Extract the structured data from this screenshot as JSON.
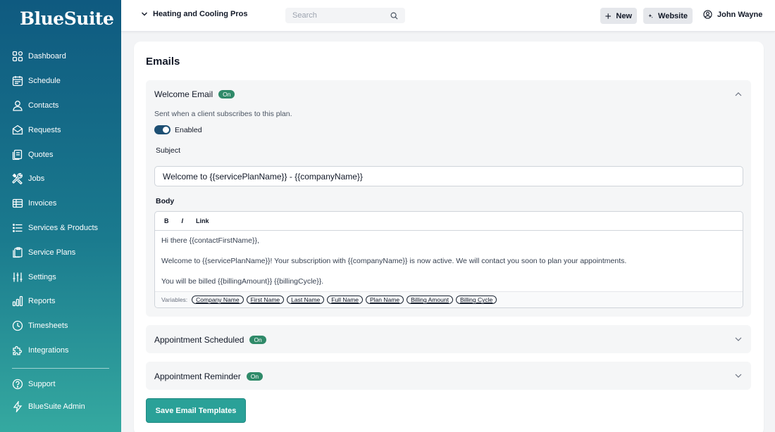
{
  "brand": {
    "logo_text": "BlueSuite"
  },
  "sidebar": {
    "items": [
      {
        "label": "Dashboard",
        "icon": "dashboard-icon"
      },
      {
        "label": "Schedule",
        "icon": "calendar-icon"
      },
      {
        "label": "Contacts",
        "icon": "user-icon"
      },
      {
        "label": "Requests",
        "icon": "inbox-icon"
      },
      {
        "label": "Quotes",
        "icon": "quote-icon"
      },
      {
        "label": "Jobs",
        "icon": "tools-icon"
      },
      {
        "label": "Invoices",
        "icon": "invoice-icon"
      },
      {
        "label": "Services & Products",
        "icon": "list-icon"
      },
      {
        "label": "Service Plans",
        "icon": "clipboard-icon"
      },
      {
        "label": "Settings",
        "icon": "sliders-icon"
      },
      {
        "label": "Reports",
        "icon": "bar-chart-icon"
      },
      {
        "label": "Timesheets",
        "icon": "clock-icon"
      },
      {
        "label": "Integrations",
        "icon": "puzzle-icon"
      }
    ],
    "bottom_items": [
      {
        "label": "Support",
        "icon": "help-icon"
      },
      {
        "label": "BlueSuite Admin",
        "icon": "bolt-icon"
      }
    ]
  },
  "topbar": {
    "company_name": "Heating and Cooling Pros",
    "search_placeholder": "Search",
    "new_label": "New",
    "website_label": "Website",
    "user_name": "John Wayne"
  },
  "main": {
    "title": "Emails",
    "welcome": {
      "title": "Welcome Email",
      "badge": "On",
      "description": "Sent when a client subscribes to this plan.",
      "toggle_label": "Enabled",
      "toggle_on": true,
      "subject_label": "Subject",
      "subject_value": "Welcome to {{servicePlanName}} - {{companyName}}",
      "body_label": "Body",
      "toolbar": {
        "bold": "B",
        "italic": "I",
        "link": "Link"
      },
      "body_lines": [
        "Hi there {{contactFirstName}},",
        "Welcome to {{servicePlanName}}! Your subscription with {{companyName}} is now active. We will contact you soon to plan your appointments.",
        "You will be billed {{billingAmount}} {{billingCycle}}."
      ],
      "variables_label": "Variables:",
      "variables": [
        "Company Name",
        "First Name",
        "Last Name",
        "Full Name",
        "Plan Name",
        "Billing Amount",
        "Billing Cycle"
      ]
    },
    "appointment_scheduled": {
      "title": "Appointment Scheduled",
      "badge": "On"
    },
    "appointment_reminder": {
      "title": "Appointment Reminder",
      "badge": "On"
    },
    "save_label": "Save Email Templates"
  },
  "colors": {
    "accent": "#2aa198",
    "badge_green": "#2f8a69",
    "toggle_blue": "#1d4f73",
    "sidebar_top": "#0f5a80",
    "sidebar_bottom": "#35a9a0"
  }
}
